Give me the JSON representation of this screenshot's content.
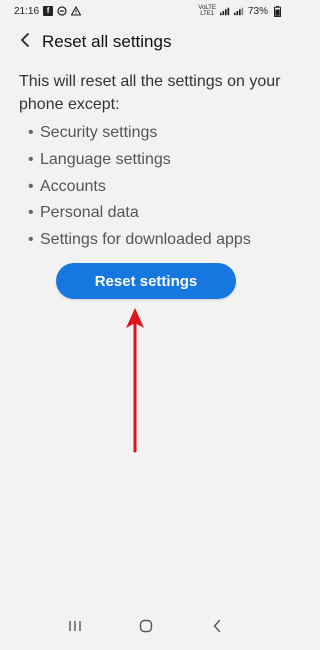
{
  "status_bar": {
    "time": "21:16",
    "network_label_top": "VoLTE",
    "network_label_bottom": "LTE1",
    "battery": "73%"
  },
  "header": {
    "title": "Reset all settings"
  },
  "content": {
    "intro": "This will reset all the settings on your phone except:",
    "bullets": [
      "Security settings",
      "Language settings",
      "Accounts",
      "Personal data",
      "Settings for downloaded apps"
    ],
    "bullet_char": "•"
  },
  "actions": {
    "reset_label": "Reset settings"
  },
  "colors": {
    "accent": "#1777e0",
    "arrow": "#e1141c",
    "background": "#f2f2f2"
  },
  "icons": {
    "back": "chevron-left-icon",
    "recents": "recents-icon",
    "home": "home-icon",
    "nav_back": "nav-back-icon"
  }
}
